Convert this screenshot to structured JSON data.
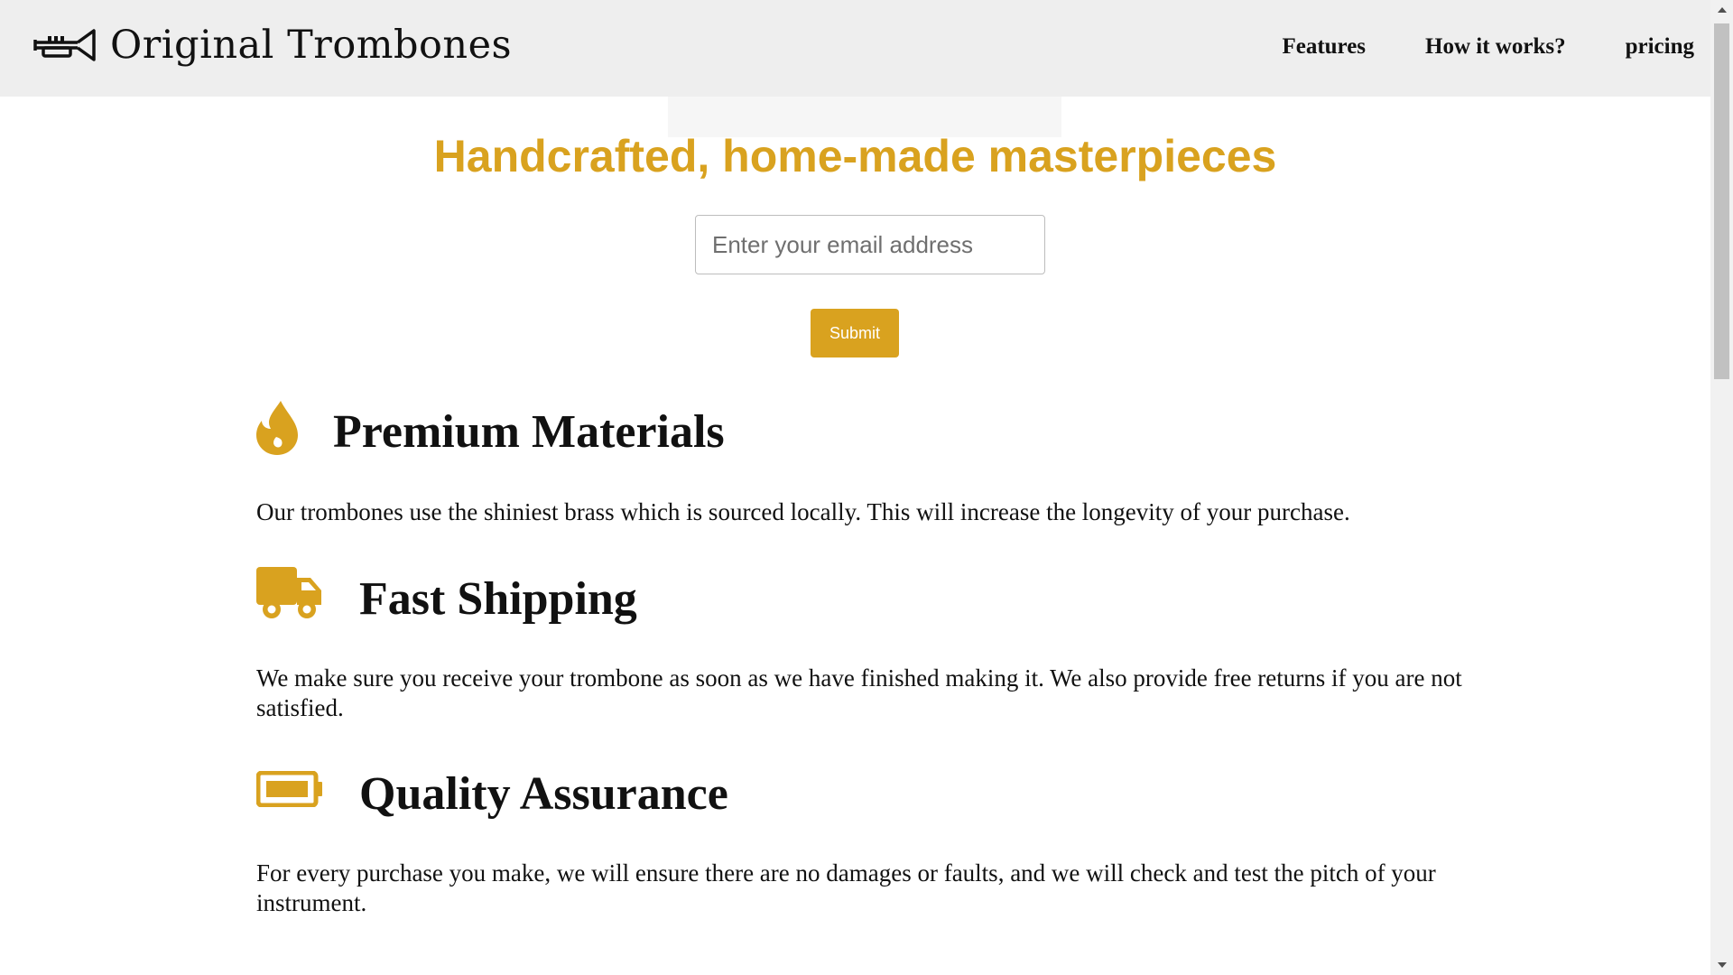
{
  "header": {
    "logo_text": "Original Trombones",
    "nav": [
      "Features",
      "How it works?",
      "pricing"
    ]
  },
  "hero": {
    "title": "Handcrafted, home-made masterpieces",
    "email_placeholder": "Enter your email address",
    "submit_label": "Submit"
  },
  "features": [
    {
      "icon": "fire-icon",
      "title": "Premium Materials",
      "description": "Our trombones use the shiniest brass which is sourced locally. This will increase the longevity of your purchase."
    },
    {
      "icon": "truck-icon",
      "title": "Fast Shipping",
      "description": "We make sure you receive your trombone as soon as we have finished making it. We also provide free returns if you are not satisfied."
    },
    {
      "icon": "battery-icon",
      "title": "Quality Assurance",
      "description": "For every purchase you make, we will ensure there are no damages or faults, and we will check and test the pitch of your instrument."
    }
  ],
  "colors": {
    "accent": "#d9a21f",
    "header_bg": "#eeeeee",
    "text": "#111111"
  }
}
